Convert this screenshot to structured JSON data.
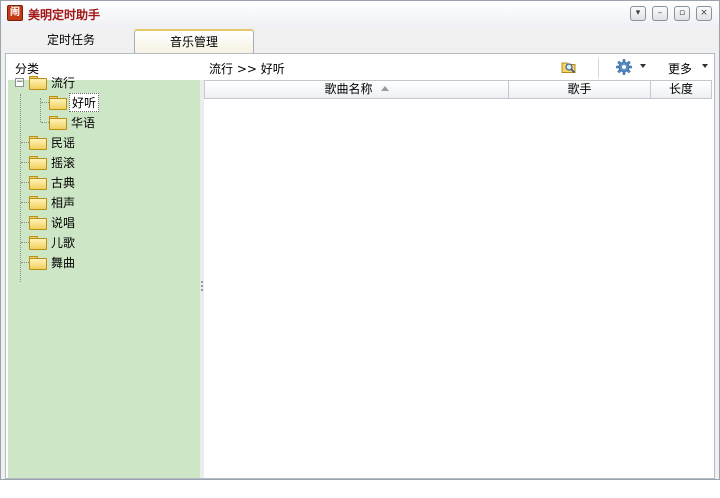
{
  "window": {
    "title": "美明定时助手",
    "app_icon_glyph": "闹"
  },
  "tabs": [
    {
      "label": "定时任务",
      "active": false
    },
    {
      "label": "音乐管理",
      "active": true
    }
  ],
  "toolbar": {
    "category_label": "分类",
    "breadcrumb": "流行 >> 好听",
    "more_label": "更多",
    "search_icon": "folder-search-icon",
    "settings_icon": "gear-icon"
  },
  "tree": {
    "root": {
      "label": "流行",
      "expanded": true,
      "children": [
        {
          "label": "好听",
          "selected": true
        },
        {
          "label": "华语",
          "selected": false
        }
      ]
    },
    "items": [
      "民谣",
      "摇滚",
      "古典",
      "相声",
      "说唱",
      "儿歌",
      "舞曲"
    ]
  },
  "table": {
    "columns": [
      "歌曲名称",
      "歌手",
      "长度"
    ],
    "sort_column": "歌曲名称",
    "sort_direction": "asc",
    "rows": []
  },
  "colors": {
    "sidebar_bg": "#cde6c5",
    "title_text": "#a31515",
    "active_tab_accent": "#e4c76a"
  }
}
